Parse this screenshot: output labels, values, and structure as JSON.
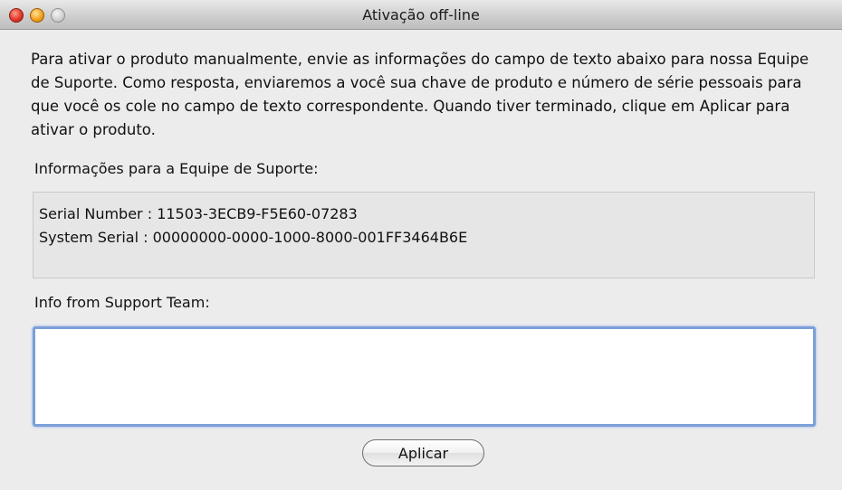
{
  "window": {
    "title": "Ativação off-line"
  },
  "instructions": "Para ativar o produto manualmente, envie as informações do campo de texto abaixo para nossa Equipe de Suporte. Como resposta, enviaremos a você sua chave de produto e número de série pessoais para que você os cole no campo de texto correspondente. Quando tiver terminado, clique em Aplicar para ativar o produto.",
  "support_info": {
    "label": "Informações para a Equipe de Suporte:",
    "lines": [
      "Serial Number : 11503-3ECB9-F5E60-07283",
      "System Serial : 00000000-0000-1000-8000-001FF3464B6E"
    ]
  },
  "reply": {
    "label": "Info from Support Team:",
    "value": ""
  },
  "buttons": {
    "apply_label": "Aplicar"
  },
  "colors": {
    "window_background": "#ececec",
    "focus_ring": "#7d9fd9",
    "close": "#e0392b",
    "minimize": "#f2a21f",
    "zoom": "#cfcfcf"
  }
}
